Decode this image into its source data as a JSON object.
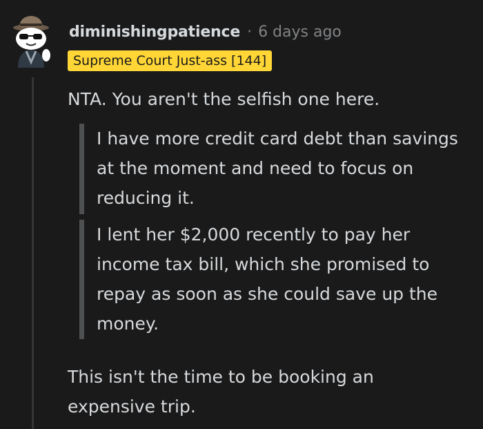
{
  "comment": {
    "author": "diminishingpatience",
    "separator": "·",
    "timestamp": "6 days ago",
    "flair": "Supreme Court Just-ass [144]",
    "avatar_icon": "snoo-detective-avatar-icon",
    "body": {
      "intro": "NTA. You aren't the selfish one here.",
      "quotes": [
        "I have more credit card debt than savings at the moment and need to focus on reducing it.",
        "I lent her $2,000 recently to pay her income tax bill, which she promised to repay as soon as she could save up the money."
      ],
      "outro": "This isn't the time to be booking an expensive trip."
    }
  },
  "colors": {
    "background": "#1a1a1b",
    "text": "#d7dadc",
    "muted": "#818384",
    "flair_bg": "#ffd635",
    "quote_bar": "#4f5052",
    "thread_line": "#343536"
  }
}
